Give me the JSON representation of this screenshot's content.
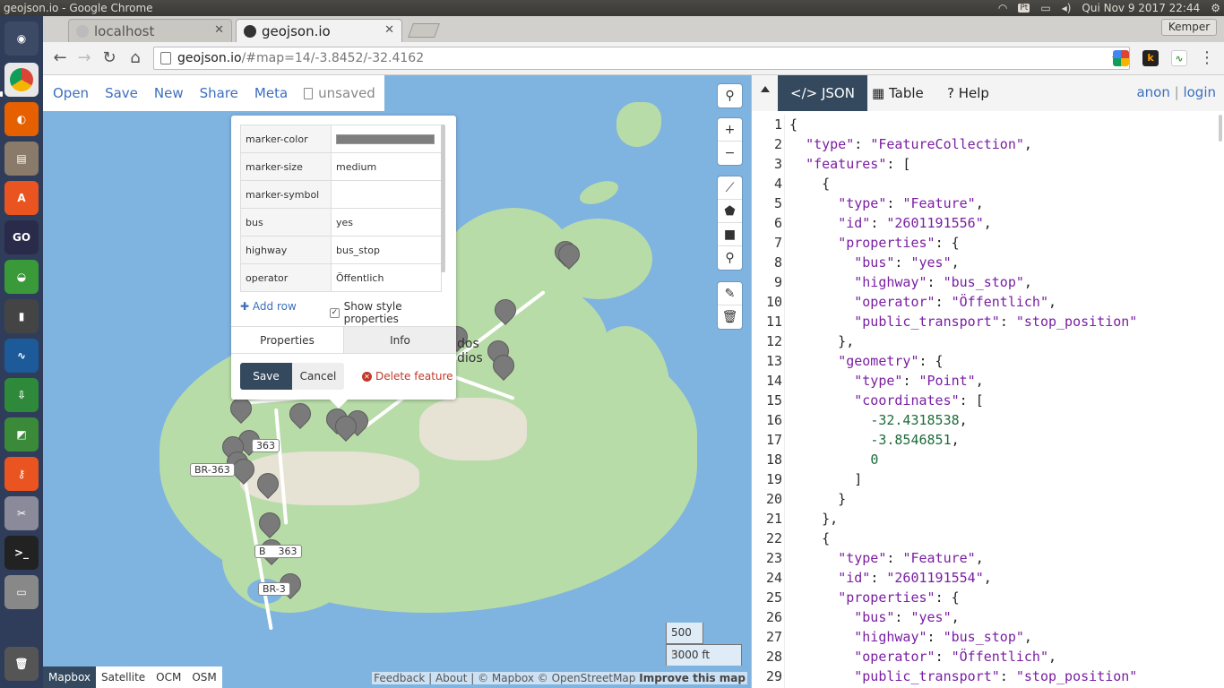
{
  "window_title": "geojson.io - Google Chrome",
  "tray": {
    "keyboard": "Pt",
    "clock": "Qui Nov 9 2017 22:44"
  },
  "browser": {
    "tabs": [
      {
        "label": "localhost"
      },
      {
        "label": "geojson.io"
      }
    ],
    "profile": "Kemper",
    "url_host": "geojson.io",
    "url_path": "/#map=14/-3.8452/-32.4162"
  },
  "map_menu": {
    "open": "Open",
    "save": "Save",
    "new": "New",
    "share": "Share",
    "meta": "Meta",
    "unsaved": "unsaved"
  },
  "popup": {
    "rows": [
      {
        "key": "marker-color",
        "value": ""
      },
      {
        "key": "marker-size",
        "value": "medium"
      },
      {
        "key": "marker-symbol",
        "value": ""
      },
      {
        "key": "bus",
        "value": "yes"
      },
      {
        "key": "highway",
        "value": "bus_stop"
      },
      {
        "key": "operator",
        "value": "Öffentlich"
      }
    ],
    "marker_color_hex": "#7e7e7e",
    "add_row": "Add row",
    "show_style": "Show style properties",
    "tab_properties": "Properties",
    "tab_info": "Info",
    "save": "Save",
    "cancel": "Cancel",
    "delete": "Delete feature"
  },
  "map_labels": {
    "place_1": "dos",
    "place_2": "dios",
    "shield_1": "363",
    "shield_2": "BR-363",
    "shield_3": "B",
    "shield_3b": "363",
    "shield_4": "BR-3"
  },
  "scale": {
    "metric": "500 m",
    "imperial": "3000 ft"
  },
  "layers": [
    "Mapbox",
    "Satellite",
    "OCM",
    "OSM"
  ],
  "attribution": {
    "feedback": "Feedback",
    "about": "About",
    "text": "© Mapbox © OpenStreetMap",
    "improve": "Improve this map"
  },
  "right_tabs": {
    "json": "JSON",
    "table": "Table",
    "help": "Help"
  },
  "auth": {
    "anon": "anon",
    "login": "login"
  },
  "code_lines": [
    "{",
    "  \"type\": \"FeatureCollection\",",
    "  \"features\": [",
    "    {",
    "      \"type\": \"Feature\",",
    "      \"id\": \"2601191556\",",
    "      \"properties\": {",
    "        \"bus\": \"yes\",",
    "        \"highway\": \"bus_stop\",",
    "        \"operator\": \"Öffentlich\",",
    "        \"public_transport\": \"stop_position\"",
    "      },",
    "      \"geometry\": {",
    "        \"type\": \"Point\",",
    "        \"coordinates\": [",
    "          -32.4318538,",
    "          -3.8546851,",
    "          0",
    "        ]",
    "      }",
    "    },",
    "    {",
    "      \"type\": \"Feature\",",
    "      \"id\": \"2601191554\",",
    "      \"properties\": {",
    "        \"bus\": \"yes\",",
    "        \"highway\": \"bus_stop\",",
    "        \"operator\": \"Öffentlich\",",
    "        \"public_transport\": \"stop_position\""
  ]
}
